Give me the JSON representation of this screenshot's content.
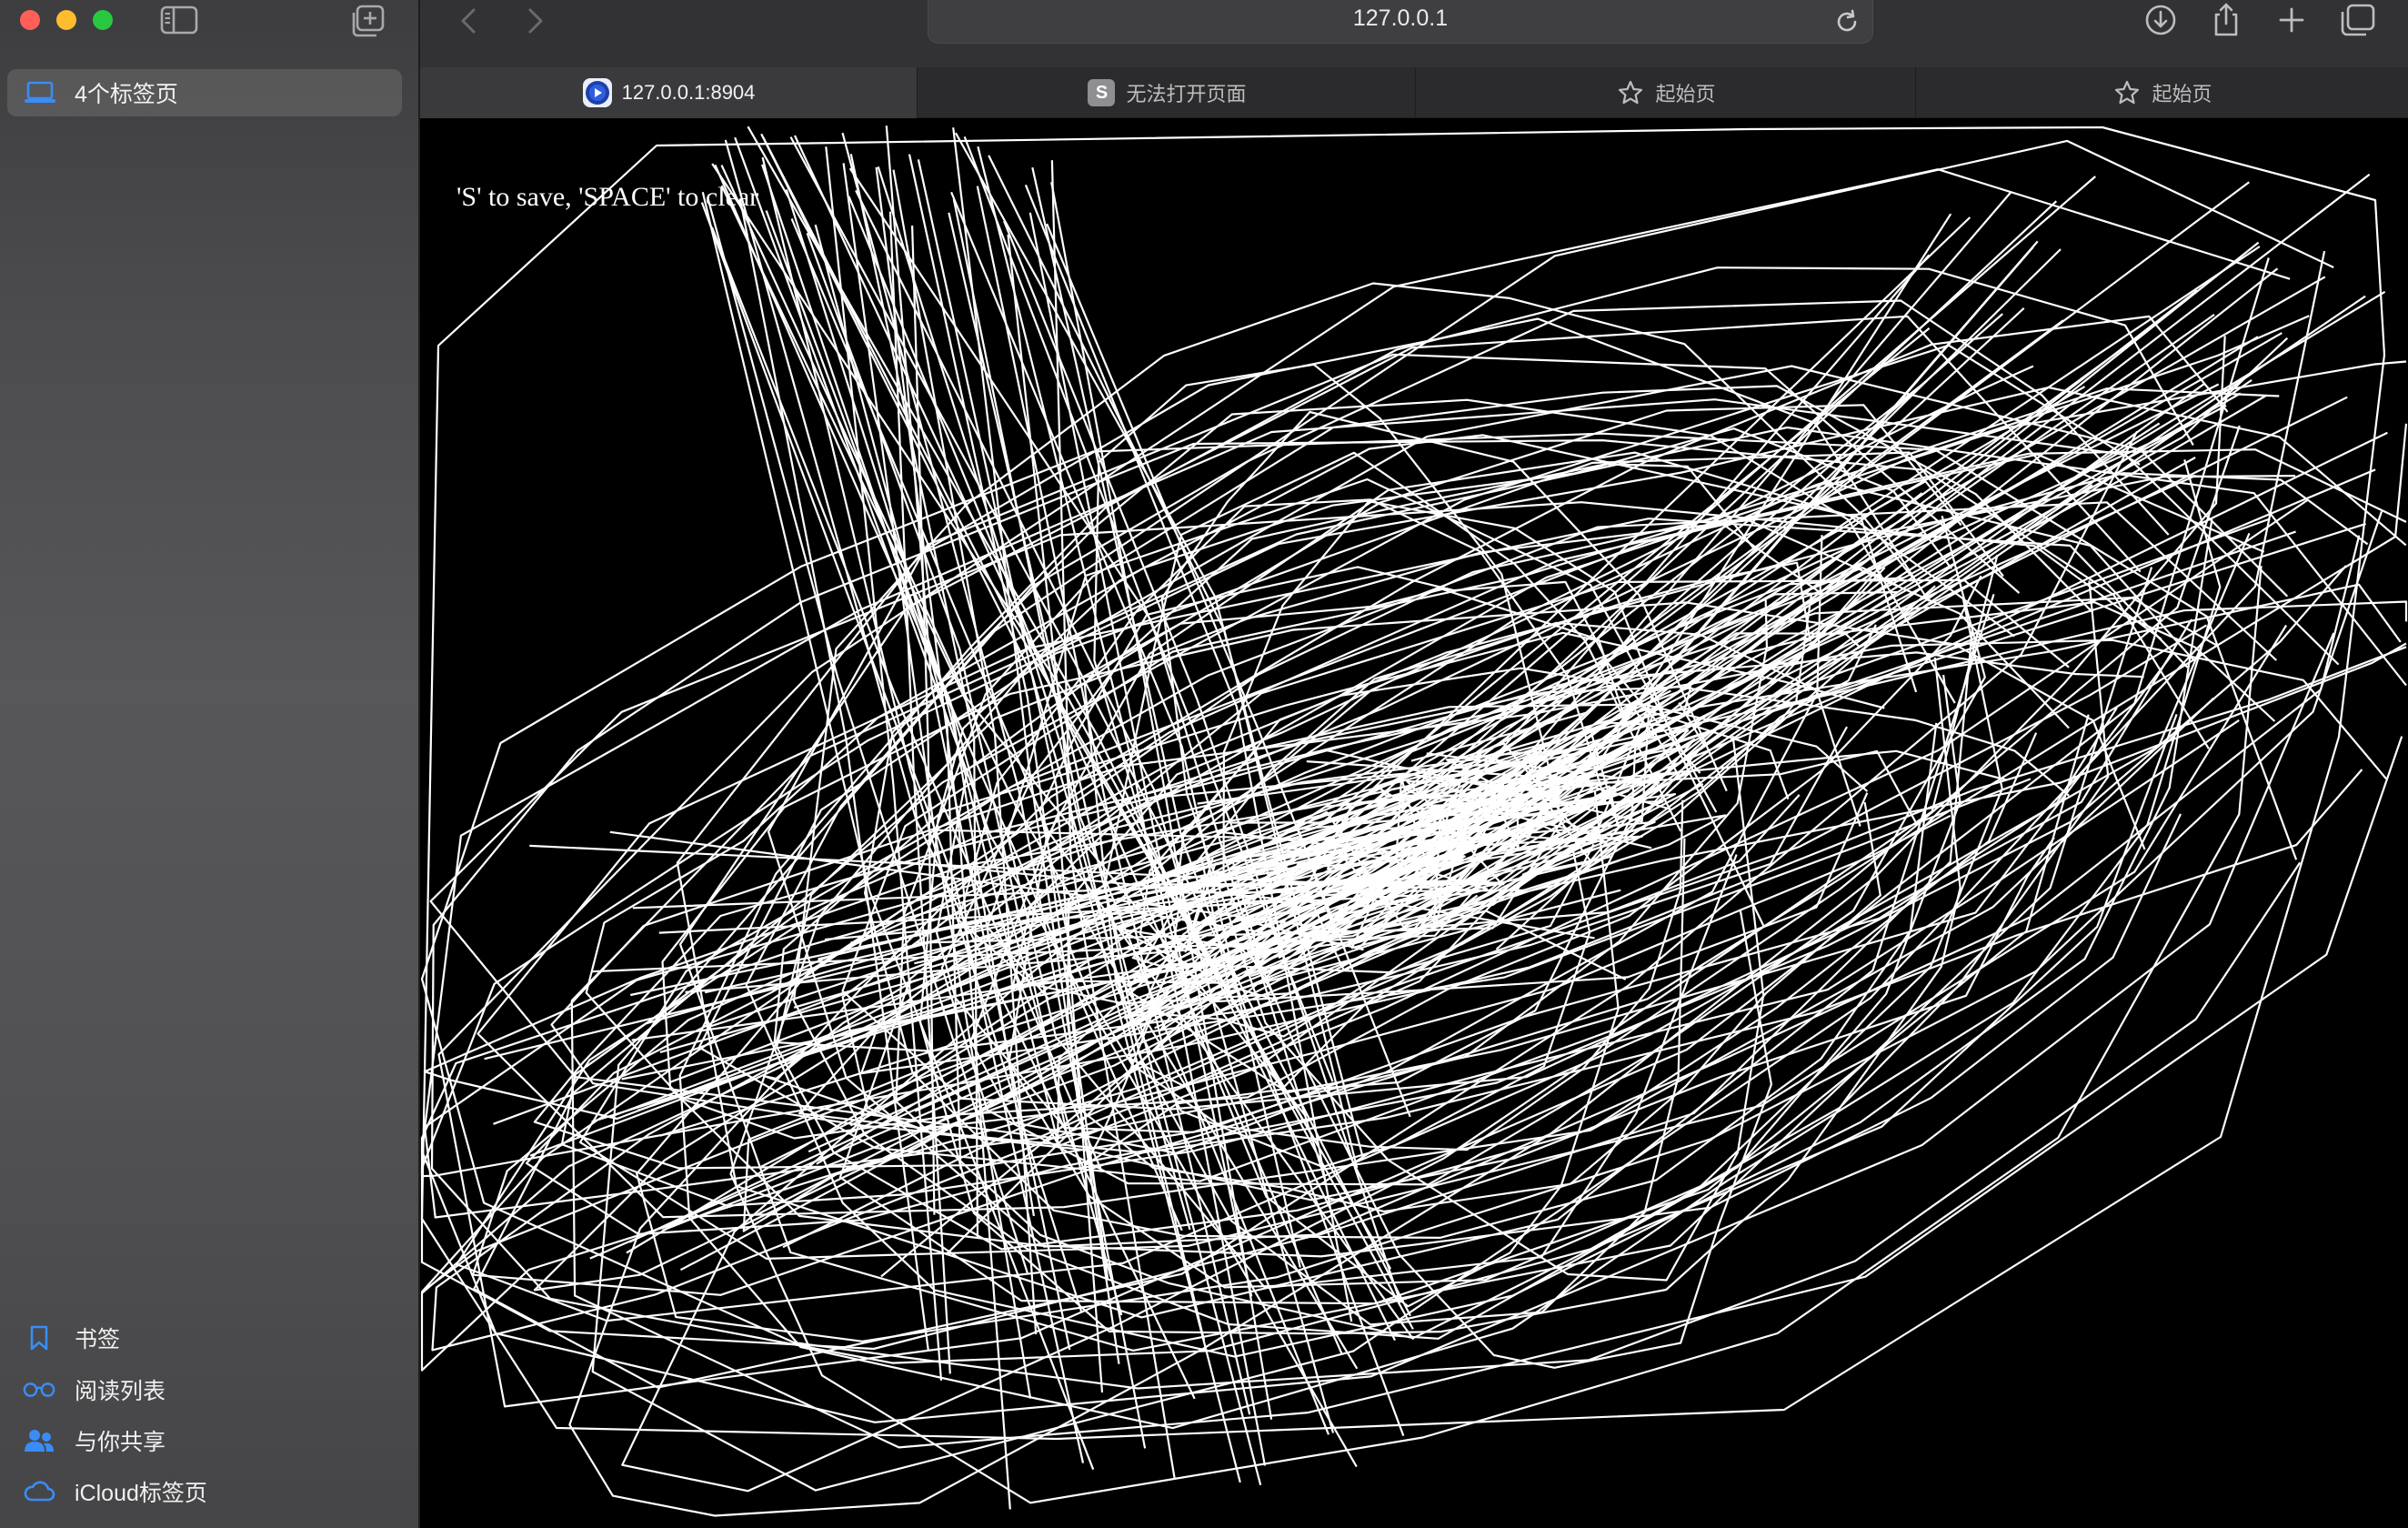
{
  "sidebar": {
    "tab_group_label": "4个标签页",
    "items": [
      {
        "label": "书签",
        "icon": "bookmark-icon"
      },
      {
        "label": "阅读列表",
        "icon": "reading-list-glasses-icon"
      },
      {
        "label": "与你共享",
        "icon": "shared-with-you-icon"
      },
      {
        "label": "iCloud标签页",
        "icon": "icloud-icon"
      }
    ]
  },
  "toolbar": {
    "url": "127.0.0.1"
  },
  "tabs": [
    {
      "title": "127.0.0.1:8904",
      "icon": "app-favicon-icon",
      "active": true
    },
    {
      "title": "无法打开页面",
      "icon": "s-favicon-icon",
      "active": false
    },
    {
      "title": "起始页",
      "icon": "star-icon",
      "active": false
    },
    {
      "title": "起始页",
      "icon": "star-icon",
      "active": false
    }
  ],
  "page": {
    "hint": "'S' to save, 'SPACE' to clear"
  },
  "colors": {
    "accent_blue": "#3b8cf5",
    "close": "#ff5f57",
    "minimize": "#febc2e",
    "zoom": "#28c840",
    "canvas_bg": "#000000",
    "stroke": "#ffffff"
  }
}
